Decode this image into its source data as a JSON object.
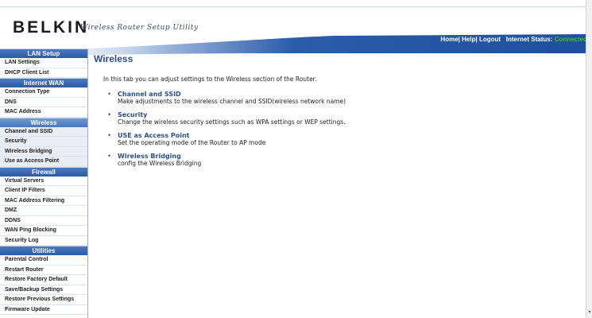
{
  "brand": {
    "name": "BELKIN",
    "tagline": "Wireless Router Setup Utility"
  },
  "topbar": {
    "links": [
      "Home",
      "Help",
      "Logout"
    ],
    "separator": "|",
    "status_label": "Internet Status:",
    "status_value": "Connected",
    "status_color": "#3fbf3a"
  },
  "sidebar": {
    "sections": [
      {
        "title": "LAN Setup",
        "active": false,
        "items": [
          "LAN Settings",
          "DHCP Client List"
        ]
      },
      {
        "title": "Internet WAN",
        "active": false,
        "items": [
          "Connection Type",
          "DNS",
          "MAC Address"
        ]
      },
      {
        "title": "Wireless",
        "active": true,
        "items": [
          "Channel and SSID",
          "Security",
          "Wireless Bridging",
          "Use as Access Point"
        ]
      },
      {
        "title": "Firewall",
        "active": false,
        "items": [
          "Virtual Servers",
          "Client IP Filters",
          "MAC Address Filtering",
          "DMZ",
          "DDNS",
          "WAN Ping Blocking",
          "Security Log"
        ]
      },
      {
        "title": "Utilities",
        "active": false,
        "items": [
          "Parental Control",
          "Restart Router",
          "Restore Factory Default",
          "Save/Backup Settings",
          "Restore Previous Settings",
          "Firmware Update"
        ]
      }
    ]
  },
  "main": {
    "title": "Wireless",
    "intro": "In this tab you can adjust settings to the Wireless section of the Router.",
    "options": [
      {
        "title": "Channel and SSID",
        "desc": "Make adjustments to the wireless channel and SSID(wireless network name)"
      },
      {
        "title": "Security",
        "desc": "Change the wireless security settings such as WPA settings or WEP settings."
      },
      {
        "title": "USE as Access Point",
        "desc": "Set the operating mode of the Router to AP mode"
      },
      {
        "title": "Wireless Bridging",
        "desc": "config the Wireless Bridging"
      }
    ]
  },
  "colors": {
    "accent": "#2a4f8c",
    "nav_header": "#2c5aa3",
    "banner": "#2b5cab"
  }
}
